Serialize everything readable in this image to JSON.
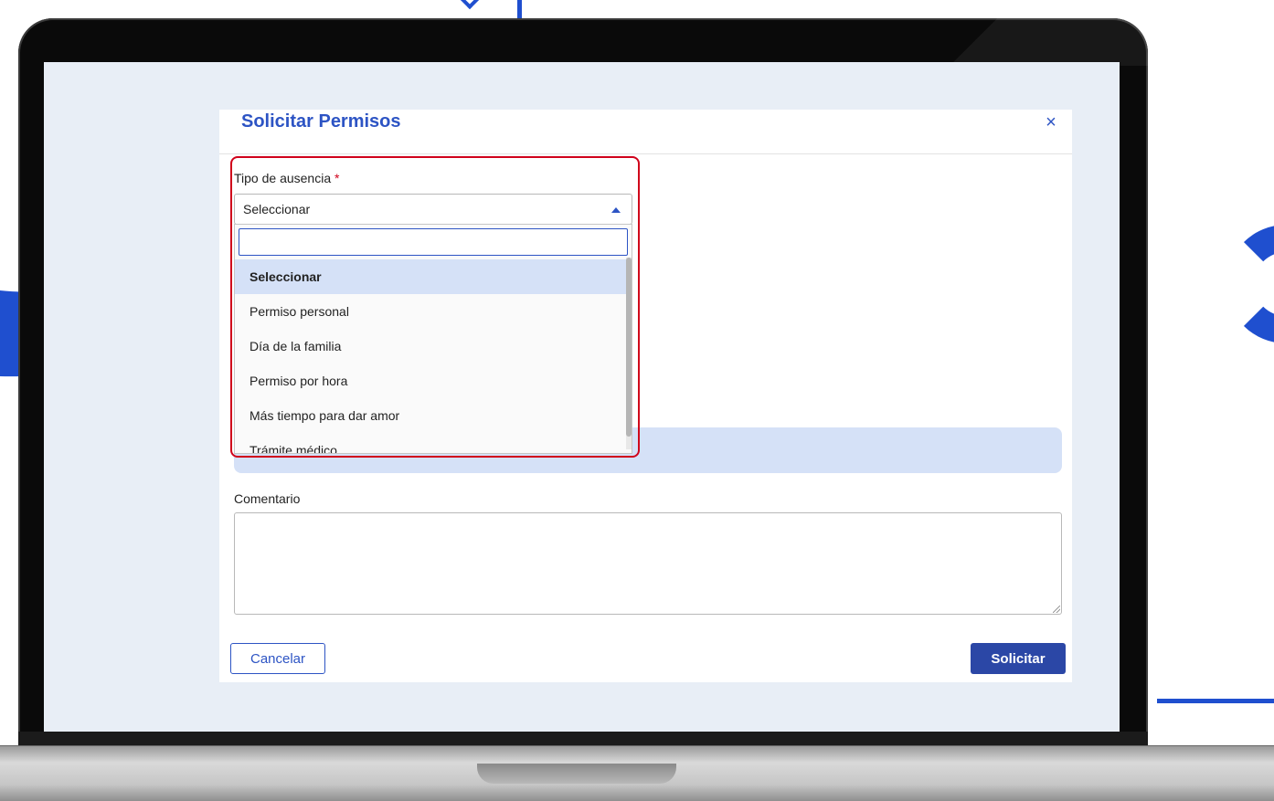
{
  "dialog": {
    "title": "Solicitar Permisos",
    "close_symbol": "×"
  },
  "absence_type": {
    "label": "Tipo de ausencia",
    "required_mark": "*",
    "selected_value": "Seleccionar",
    "search_value": "",
    "options": [
      "Seleccionar",
      "Permiso personal",
      "Día de la familia",
      "Permiso por hora",
      "Más tiempo para dar amor",
      "Trámite médico"
    ],
    "highlighted_option_index": 0
  },
  "comment": {
    "label": "Comentario",
    "value": ""
  },
  "actions": {
    "cancel_label": "Cancelar",
    "submit_label": "Solicitar"
  },
  "colors": {
    "accent": "#2d54c4",
    "submit": "#2b47a6",
    "highlight_frame": "#d0021b",
    "selected_option": "#d5e1f7",
    "screen_background": "#e8eef6"
  },
  "icons": {
    "close": "close-icon",
    "dropdown_caret": "caret-up-icon"
  }
}
